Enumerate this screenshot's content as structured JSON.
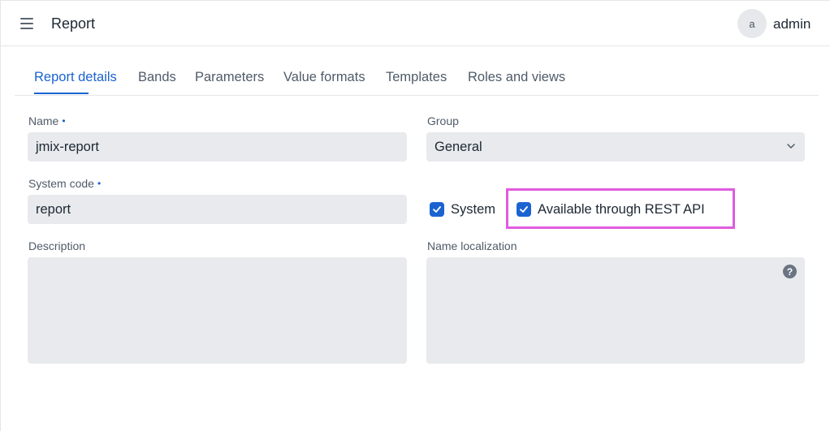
{
  "header": {
    "title": "Report",
    "avatar_initial": "a",
    "username": "admin"
  },
  "tabs": [
    {
      "label": "Report details",
      "active": true
    },
    {
      "label": "Bands"
    },
    {
      "label": "Parameters"
    },
    {
      "label": "Value formats"
    },
    {
      "label": "Templates"
    },
    {
      "label": "Roles and views"
    }
  ],
  "form": {
    "name": {
      "label": "Name",
      "required_marker": "•",
      "value": "jmix-report"
    },
    "group": {
      "label": "Group",
      "value": "General"
    },
    "system_code": {
      "label": "System code",
      "required_marker": "•",
      "value": "report"
    },
    "system": {
      "label": "System",
      "checked": true
    },
    "rest_api": {
      "label": "Available through REST API",
      "checked": true
    },
    "description": {
      "label": "Description",
      "value": ""
    },
    "name_localization": {
      "label": "Name localization",
      "value": "",
      "help_icon": "?"
    }
  },
  "colors": {
    "accent": "#1a63d1",
    "highlight": "#e05be0",
    "field_bg": "#e8eaed"
  }
}
